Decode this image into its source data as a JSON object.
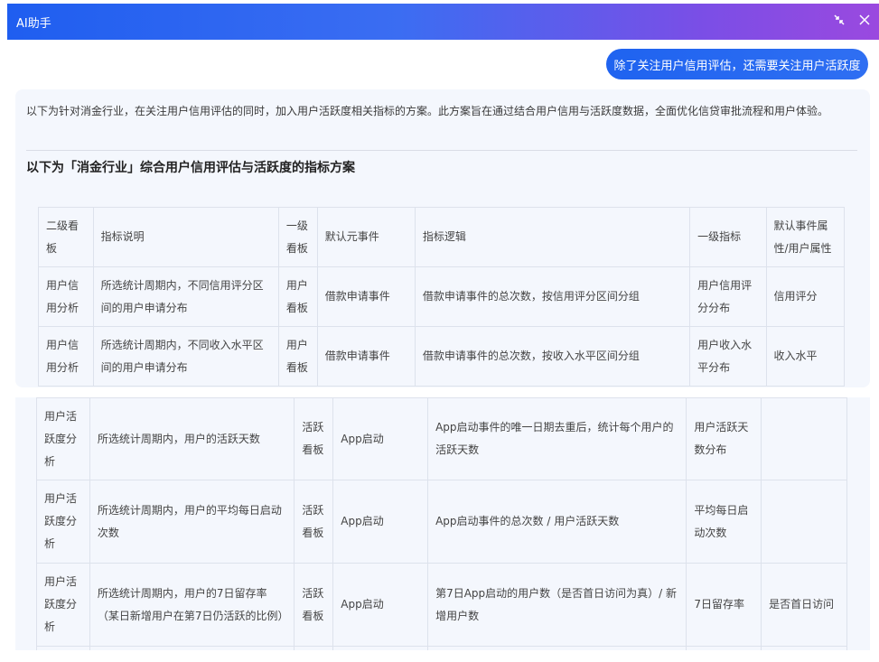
{
  "window": {
    "title": "AI助手",
    "controls": [
      {
        "icon": "collapse-icon"
      },
      {
        "icon": "close-icon"
      }
    ],
    "colors": {
      "gradient_start": "#1f5ef0",
      "gradient_end": "#9a49df"
    }
  },
  "user_message": "除了关注用户信用评估，还需要关注用户活跃度",
  "answer": {
    "intro": "以下为针对消金行业，在关注用户信用评估的同时，加入用户活跃度相关指标的方案。此方案旨在通过结合用户信用与活跃度数据，全面优化信贷审批流程和用户体验。",
    "heading": "以下为「消金行业」综合用户信用评估与活跃度的指标方案",
    "table_upper": {
      "headers": [
        "二级看板",
        "指标说明",
        "一级看板",
        "默认元事件",
        "指标逻辑",
        "一级指标",
        "默认事件属性/用户属性"
      ],
      "rows": [
        [
          "用户信用分析",
          "所选统计周期内，不同信用评分区间的用户申请分布",
          "用户看板",
          "借款申请事件",
          "借款申请事件的总次数，按信用评分区间分组",
          "用户信用评分分布",
          "信用评分"
        ],
        [
          "用户信用分析",
          "所选统计周期内，不同收入水平区间的用户申请分布",
          "用户看板",
          "借款申请事件",
          "借款申请事件的总次数，按收入水平区间分组",
          "用户收入水平分布",
          "收入水平"
        ]
      ]
    },
    "table_lower": {
      "rows": [
        [
          "用户活跃度分析",
          "所选统计周期内，用户的活跃天数",
          "活跃看板",
          "App启动",
          "App启动事件的唯一日期去重后，统计每个用户的活跃天数",
          "用户活跃天数分布",
          ""
        ],
        [
          "用户活跃度分析",
          "所选统计周期内，用户的平均每日启动次数",
          "活跃看板",
          "App启动",
          "App启动事件的总次数 / 用户活跃天数",
          "平均每日启动次数",
          ""
        ],
        [
          "用户活跃度分析",
          "所选统计周期内，用户的7日留存率（某日新增用户在第7日仍活跃的比例）",
          "活跃看板",
          "App启动",
          "第7日App启动的用户数（是否首日访问为真）/ 新增用户数",
          "7日留存率",
          "是否首日访问"
        ]
      ]
    }
  }
}
